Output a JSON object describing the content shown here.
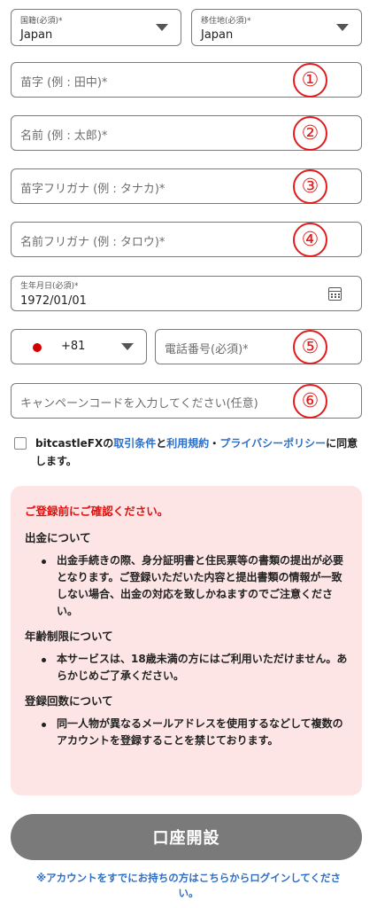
{
  "nationality": {
    "label": "国籍(必須)*",
    "value": "Japan"
  },
  "residence": {
    "label": "移住地(必須)*",
    "value": "Japan"
  },
  "last_name": {
    "placeholder": "苗字 (例 : 田中)*",
    "badge": "①"
  },
  "first_name": {
    "placeholder": "名前 (例 : 太郎)*",
    "badge": "②"
  },
  "last_name_kana": {
    "placeholder": "苗字フリガナ (例 : タナカ)*",
    "badge": "③"
  },
  "first_name_kana": {
    "placeholder": "名前フリガナ (例 : タロウ)*",
    "badge": "④"
  },
  "birthdate": {
    "label": "生年月日(必須)*",
    "value": "1972/01/01"
  },
  "phone": {
    "country_code": "+81",
    "flag_color": "#d40000",
    "placeholder": "電話番号(必須)*",
    "badge": "⑤"
  },
  "campaign": {
    "placeholder": "キャンペーンコードを入力してください(任意)",
    "badge": "⑥"
  },
  "agreement": {
    "brand": "bitcastleFX",
    "of": "の",
    "terms": "取引条件",
    "and": "と",
    "usage": "利用規約",
    "dot": "・",
    "privacy": "プライバシーポリシー",
    "suffix": "に同意します。"
  },
  "notice": {
    "title": "ご登録前にご確認ください。",
    "sections": [
      {
        "heading": "出金について",
        "text": "出金手続きの際、身分証明書と住民票等の書類の提出が必要となります。ご登録いただいた内容と提出書類の情報が一致しない場合、出金の対応を致しかねますのでご注意ください。"
      },
      {
        "heading": "年齢制限について",
        "text": "本サービスは、18歳未満の方にはご利用いただけません。あらかじめご了承ください。"
      },
      {
        "heading": "登録回数について",
        "text": "同一人物が異なるメールアドレスを使用するなどして複数のアカウントを登録することを禁じております。"
      }
    ]
  },
  "submit_label": "口座開設",
  "login_link": "※アカウントをすでにお持ちの方はこちらからログインしてください。",
  "colors": {
    "accent_red": "#e21c1c",
    "link_blue": "#2d6fc6",
    "notice_bg": "#fde5e5",
    "button_gray": "#7a7a7a"
  }
}
